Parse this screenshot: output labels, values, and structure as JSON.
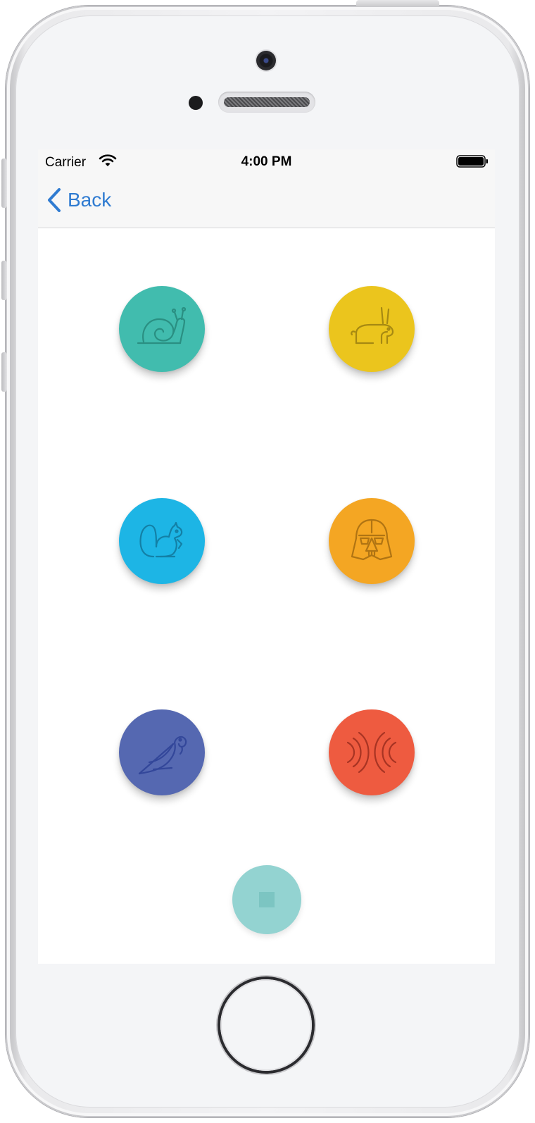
{
  "status_bar": {
    "carrier": "Carrier",
    "time": "4:00 PM",
    "wifi_icon": "wifi-icon",
    "battery_icon": "battery-icon"
  },
  "nav_bar": {
    "back_label": "Back",
    "back_icon": "chevron-left-icon",
    "tint_color": "#2f7bd1"
  },
  "animal_buttons": [
    {
      "icon": "snail-icon",
      "color": "#41bcae",
      "line_color": "#2a8f82"
    },
    {
      "icon": "rabbit-icon",
      "color": "#ebc51d",
      "line_color": "#a68912"
    },
    {
      "icon": "squirrel-icon",
      "color": "#1db5e5",
      "line_color": "#1380a6"
    },
    {
      "icon": "darth-vader-icon",
      "color": "#f4a623",
      "line_color": "#b07413"
    },
    {
      "icon": "parrot-icon",
      "color": "#5568b1",
      "line_color": "#33479a"
    },
    {
      "icon": "black-hole-icon",
      "color": "#ee5b40",
      "line_color": "#a83423"
    }
  ],
  "stop_button": {
    "icon": "stop-icon",
    "color": "#93d3d1",
    "square_color": "#7cc5c2"
  }
}
